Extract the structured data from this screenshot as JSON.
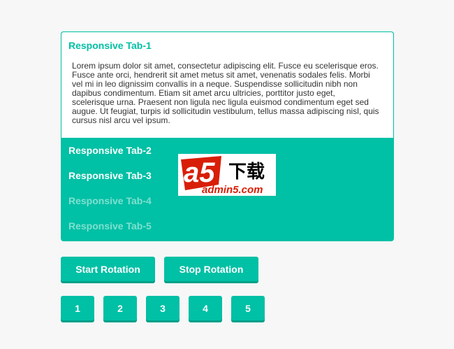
{
  "panel": {
    "title": "Responsive Tab-1",
    "text": "Lorem ipsum dolor sit amet, consectetur adipiscing elit. Fusce eu scelerisque eros. Fusce ante orci, hendrerit sit amet metus sit amet, venenatis sodales felis. Morbi vel mi in leo dignissim convallis in a neque. Suspendisse sollicitudin nibh non dapibus condimentum. Etiam sit amet arcu ultricies, porttitor justo eget, scelerisque urna. Praesent non ligula nec ligula euismod condimentum eget sed augue. Ut feugiat, turpis id sollicitudin vestibulum, tellus massa adipiscing nisl, quis cursus nisl arcu vel ipsum."
  },
  "tabs": [
    {
      "label": "Responsive Tab-2"
    },
    {
      "label": "Responsive Tab-3"
    },
    {
      "label": "Responsive Tab-4"
    },
    {
      "label": "Responsive Tab-5"
    }
  ],
  "logo": {
    "brand": "a5",
    "tagline": "下载",
    "domain": "admin5.com"
  },
  "controls": {
    "start_label": "Start Rotation",
    "stop_label": "Stop Rotation"
  },
  "pager": [
    "1",
    "2",
    "3",
    "4",
    "5"
  ],
  "colors": {
    "accent": "#00c0a5",
    "accent_dark": "#00a08a",
    "tab_dim": "#7fe0d1",
    "logo_red": "#d81e06",
    "background": "#f7f7f7"
  }
}
